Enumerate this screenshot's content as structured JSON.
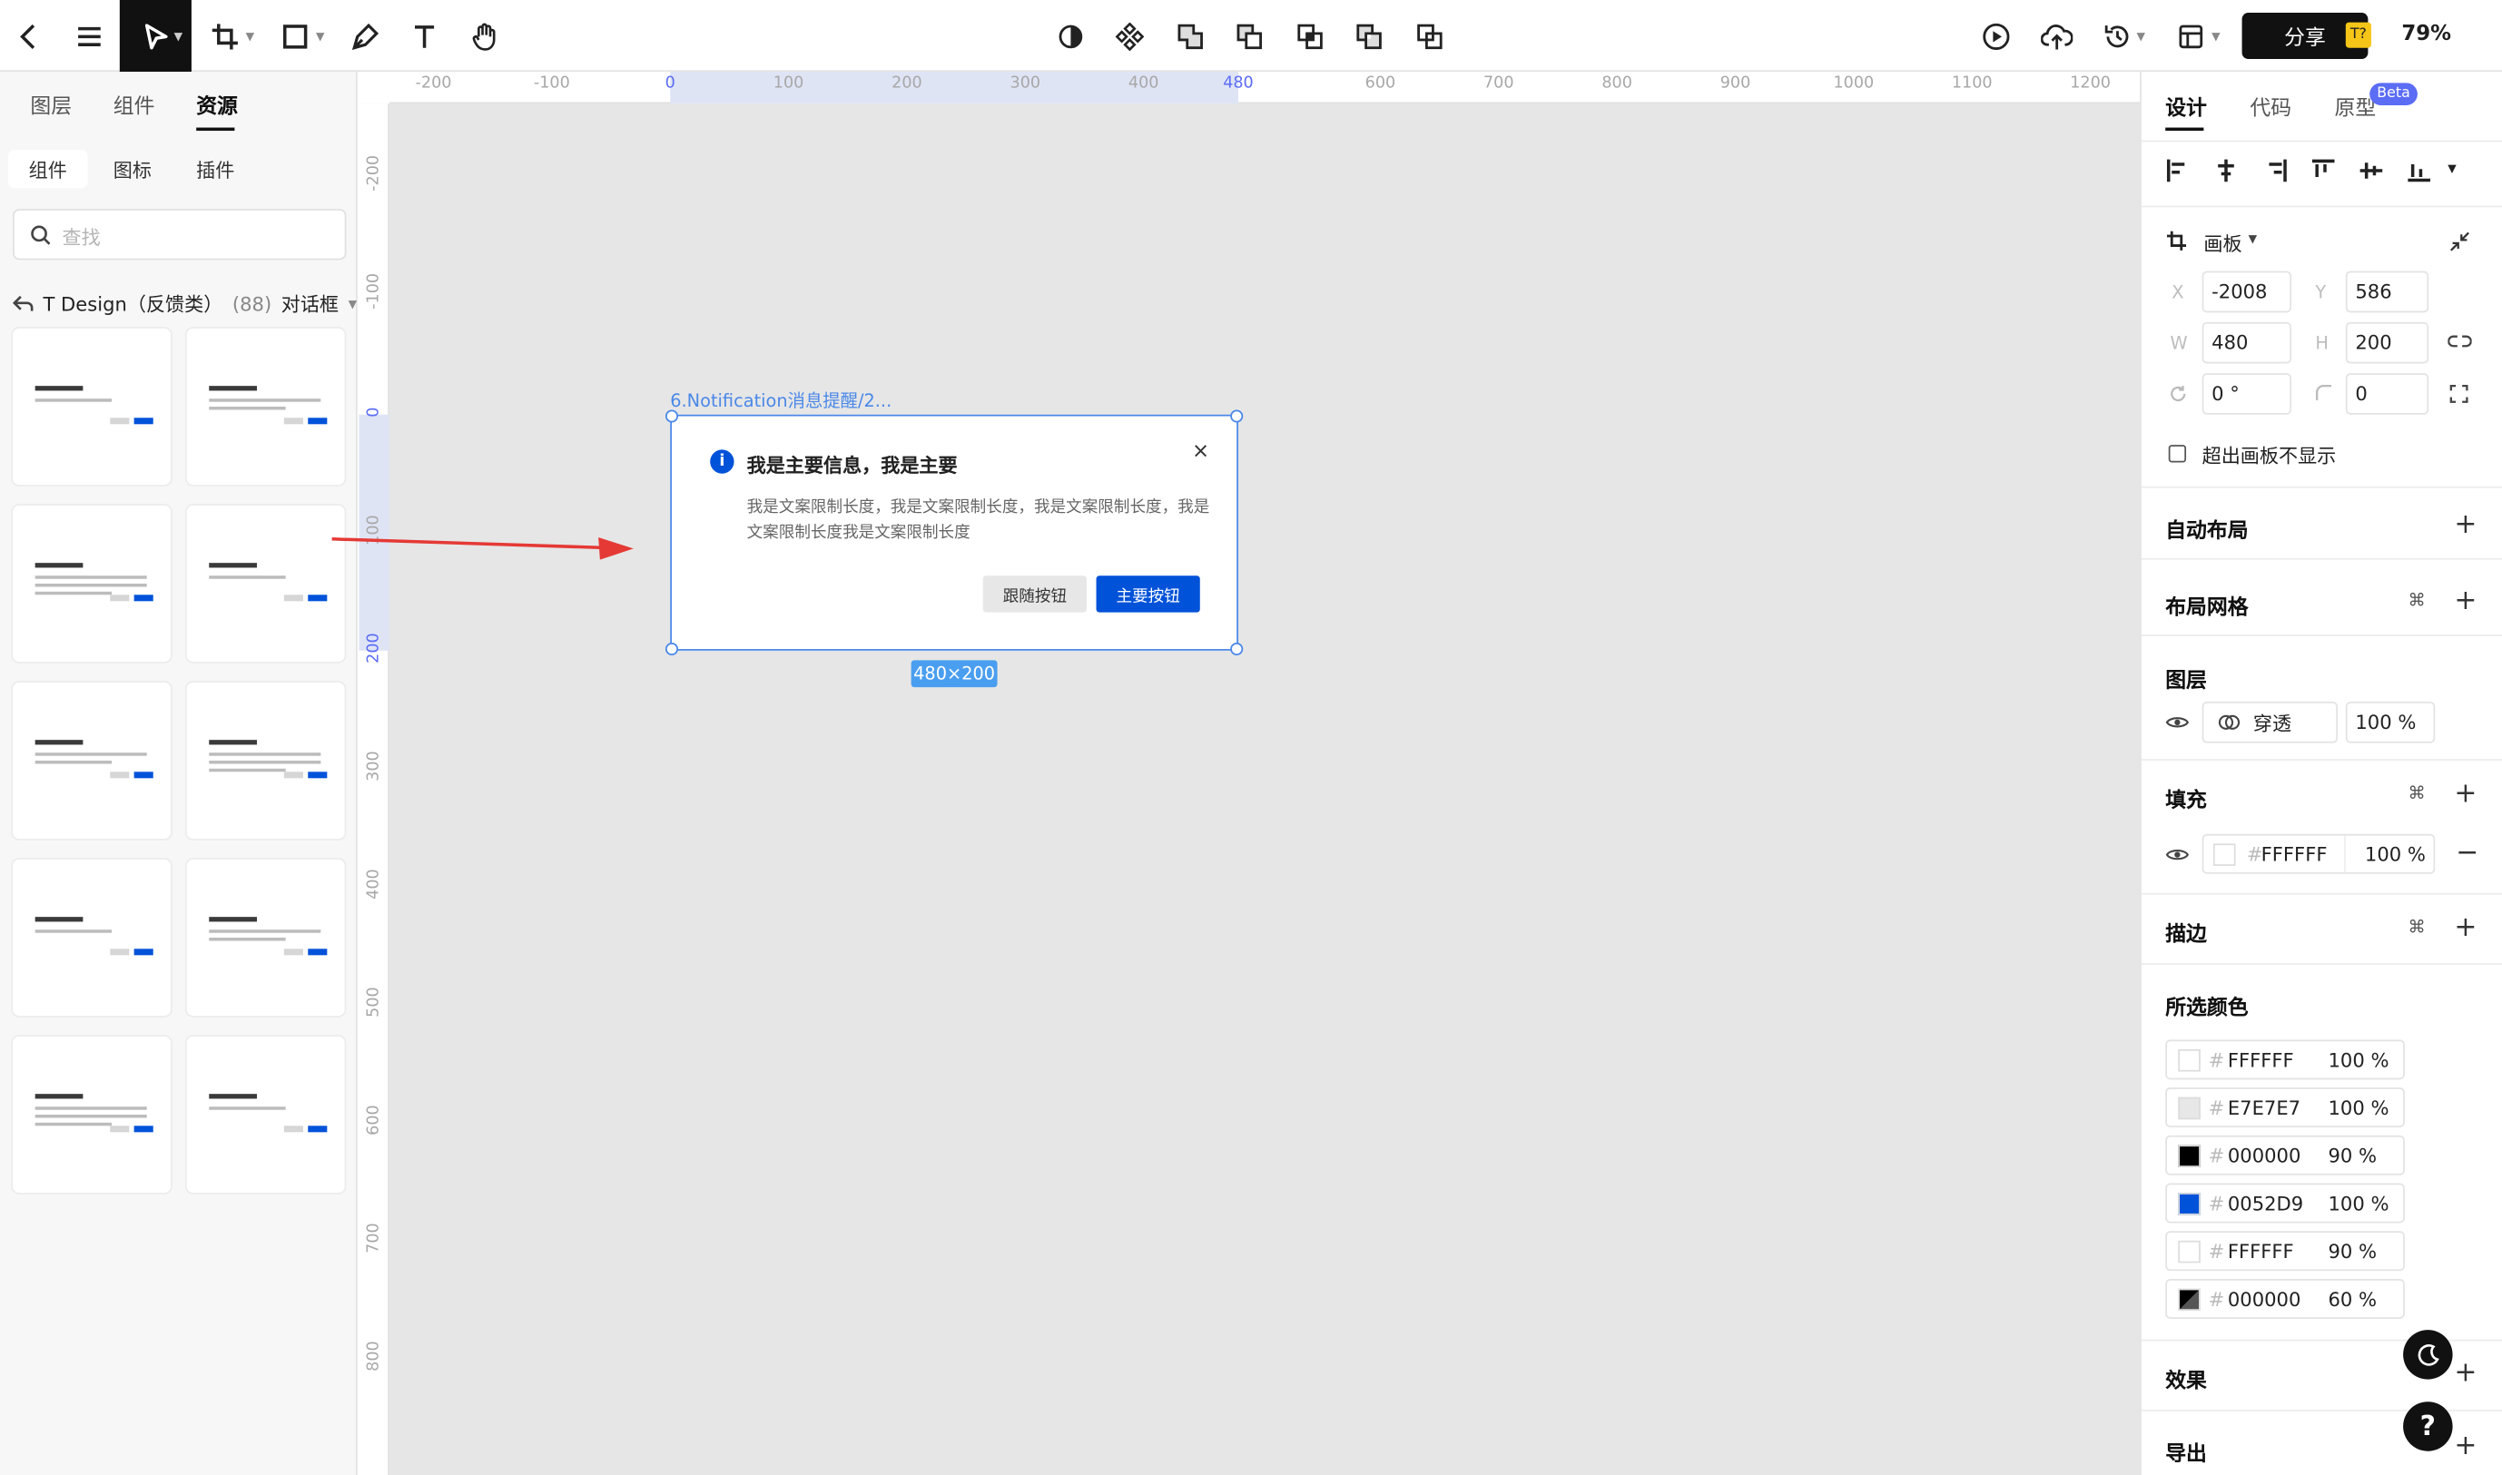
{
  "top_bar": {
    "share_label": "分享",
    "badge": "T?",
    "zoom": "79%"
  },
  "left_panel": {
    "tabs": [
      "图层",
      "组件",
      "资源"
    ],
    "active_tab": "资源",
    "sub_tabs": [
      "组件",
      "图标",
      "插件"
    ],
    "search_placeholder": "查找",
    "breadcrumb": {
      "library": "T Design（反馈类）",
      "count": "(88)",
      "category": "对话框"
    },
    "thumbnail_count": 10
  },
  "canvas": {
    "ruler_top": [
      "-200",
      "-100",
      "0",
      "100",
      "200",
      "300",
      "400",
      "480",
      "600",
      "700",
      "800",
      "900",
      "1000",
      "1100",
      "1200"
    ],
    "ruler_left": [
      "-200",
      "-100",
      "0",
      "100",
      "200",
      "300",
      "400",
      "500",
      "600",
      "700",
      "800"
    ],
    "frame_label": "6.Notification消息提醒/2...",
    "dimension_badge": "480×200",
    "notification": {
      "icon": "i",
      "title": "我是主要信息，我是主要",
      "body": "我是文案限制长度，我是文案限制长度，我是文案限制长度，我是文案限制长度我是文案限制长度",
      "secondary_button": "跟随按钮",
      "primary_button": "主要按钮",
      "close": "×"
    }
  },
  "right_panel": {
    "tabs": [
      "设计",
      "代码",
      "原型"
    ],
    "active_tab": "设计",
    "beta_badge": "Beta",
    "frame_type": "画板",
    "x_label": "X",
    "x": "-2008",
    "y_label": "Y",
    "y": "586",
    "w_label": "W",
    "w": "480",
    "h_label": "H",
    "h": "200",
    "rotation": "0 °",
    "radius": "0",
    "clip_label": "超出画板不显示",
    "sections": {
      "auto_layout": "自动布局",
      "layout_grid": "布局网格",
      "layer": "图层",
      "fill": "填充",
      "stroke": "描边",
      "selected_colors": "所选颜色",
      "effects": "效果",
      "export": "导出"
    },
    "layer_blend": "穿透",
    "layer_opacity": "100 %",
    "fill": {
      "hex": "FFFFFF",
      "opacity": "100 %"
    },
    "selected_colors": [
      {
        "hex": "FFFFFF",
        "opacity": "100 %",
        "color": "#FFFFFF"
      },
      {
        "hex": "E7E7E7",
        "opacity": "100 %",
        "color": "#E7E7E7"
      },
      {
        "hex": "000000",
        "opacity": "90 %",
        "color": "#000000"
      },
      {
        "hex": "0052D9",
        "opacity": "100 %",
        "color": "#0052D9"
      },
      {
        "hex": "FFFFFF",
        "opacity": "90 %",
        "color": "#FFFFFF"
      },
      {
        "hex": "000000",
        "opacity": "60 %",
        "color": "#000000"
      }
    ]
  },
  "colors": {
    "accent": "#0052d9",
    "selection": "#4a88e8",
    "arrow": "#e53935"
  }
}
